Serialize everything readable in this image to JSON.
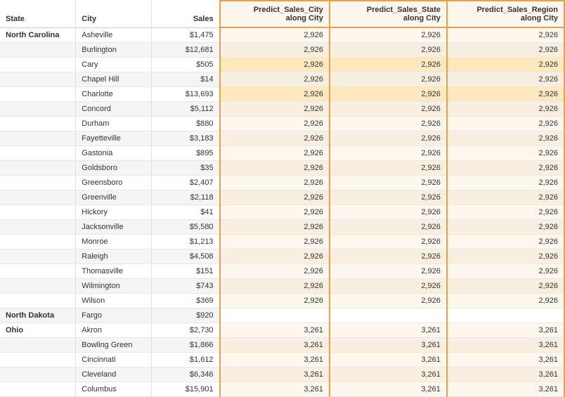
{
  "header": {
    "col_state": "State",
    "col_city": "City",
    "col_sales": "Sales",
    "col_predict_city": "Predict_Sales_City\nalong City",
    "col_predict_state": "Predict_Sales_State\nalong City",
    "col_predict_region": "Predict_Sales_Region\nalong City"
  },
  "rows": [
    {
      "state": "North Carolina",
      "city": "Asheville",
      "sales": "$1,475",
      "p_city": "2,926",
      "p_state": "2,926",
      "p_region": "2,926",
      "highlight": false
    },
    {
      "state": "",
      "city": "Burlington",
      "sales": "$12,681",
      "p_city": "2,926",
      "p_state": "2,926",
      "p_region": "2,926",
      "highlight": false
    },
    {
      "state": "",
      "city": "Cary",
      "sales": "$505",
      "p_city": "2,926",
      "p_state": "2,926",
      "p_region": "2,926",
      "highlight": true
    },
    {
      "state": "",
      "city": "Chapel Hill",
      "sales": "$14",
      "p_city": "2,926",
      "p_state": "2,926",
      "p_region": "2,926",
      "highlight": false
    },
    {
      "state": "",
      "city": "Charlotte",
      "sales": "$13,693",
      "p_city": "2,926",
      "p_state": "2,926",
      "p_region": "2,926",
      "highlight": true
    },
    {
      "state": "",
      "city": "Concord",
      "sales": "$5,112",
      "p_city": "2,926",
      "p_state": "2,926",
      "p_region": "2,926",
      "highlight": false
    },
    {
      "state": "",
      "city": "Durham",
      "sales": "$880",
      "p_city": "2,926",
      "p_state": "2,926",
      "p_region": "2,926",
      "highlight": false
    },
    {
      "state": "",
      "city": "Fayetteville",
      "sales": "$3,183",
      "p_city": "2,926",
      "p_state": "2,926",
      "p_region": "2,926",
      "highlight": false
    },
    {
      "state": "",
      "city": "Gastonia",
      "sales": "$895",
      "p_city": "2,926",
      "p_state": "2,926",
      "p_region": "2,926",
      "highlight": false
    },
    {
      "state": "",
      "city": "Goldsboro",
      "sales": "$35",
      "p_city": "2,926",
      "p_state": "2,926",
      "p_region": "2,926",
      "highlight": false
    },
    {
      "state": "",
      "city": "Greensboro",
      "sales": "$2,407",
      "p_city": "2,926",
      "p_state": "2,926",
      "p_region": "2,926",
      "highlight": false
    },
    {
      "state": "",
      "city": "Greenville",
      "sales": "$2,118",
      "p_city": "2,926",
      "p_state": "2,926",
      "p_region": "2,926",
      "highlight": false
    },
    {
      "state": "",
      "city": "Hickory",
      "sales": "$41",
      "p_city": "2,926",
      "p_state": "2,926",
      "p_region": "2,926",
      "highlight": false
    },
    {
      "state": "",
      "city": "Jacksonville",
      "sales": "$5,580",
      "p_city": "2,926",
      "p_state": "2,926",
      "p_region": "2,926",
      "highlight": false
    },
    {
      "state": "",
      "city": "Monroe",
      "sales": "$1,213",
      "p_city": "2,926",
      "p_state": "2,926",
      "p_region": "2,926",
      "highlight": false
    },
    {
      "state": "",
      "city": "Raleigh",
      "sales": "$4,508",
      "p_city": "2,926",
      "p_state": "2,926",
      "p_region": "2,926",
      "highlight": false
    },
    {
      "state": "",
      "city": "Thomasville",
      "sales": "$151",
      "p_city": "2,926",
      "p_state": "2,926",
      "p_region": "2,926",
      "highlight": false
    },
    {
      "state": "",
      "city": "Wilmington",
      "sales": "$743",
      "p_city": "2,926",
      "p_state": "2,926",
      "p_region": "2,926",
      "highlight": false
    },
    {
      "state": "",
      "city": "Wilson",
      "sales": "$369",
      "p_city": "2,926",
      "p_state": "2,926",
      "p_region": "2,926",
      "highlight": false
    },
    {
      "state": "North Dakota",
      "city": "Fargo",
      "sales": "$920",
      "p_city": "",
      "p_state": "",
      "p_region": "",
      "highlight": false,
      "nd": true
    },
    {
      "state": "Ohio",
      "city": "Akron",
      "sales": "$2,730",
      "p_city": "3,261",
      "p_state": "3,261",
      "p_region": "3,261",
      "highlight": false
    },
    {
      "state": "",
      "city": "Bowling Green",
      "sales": "$1,866",
      "p_city": "3,261",
      "p_state": "3,261",
      "p_region": "3,261",
      "highlight": false
    },
    {
      "state": "",
      "city": "Cincinnati",
      "sales": "$1,612",
      "p_city": "3,261",
      "p_state": "3,261",
      "p_region": "3,261",
      "highlight": false
    },
    {
      "state": "",
      "city": "Cleveland",
      "sales": "$6,346",
      "p_city": "3,261",
      "p_state": "3,261",
      "p_region": "3,261",
      "highlight": false
    },
    {
      "state": "",
      "city": "Columbus",
      "sales": "$15,901",
      "p_city": "3,261",
      "p_state": "3,261",
      "p_region": "3,261",
      "highlight": false
    }
  ]
}
